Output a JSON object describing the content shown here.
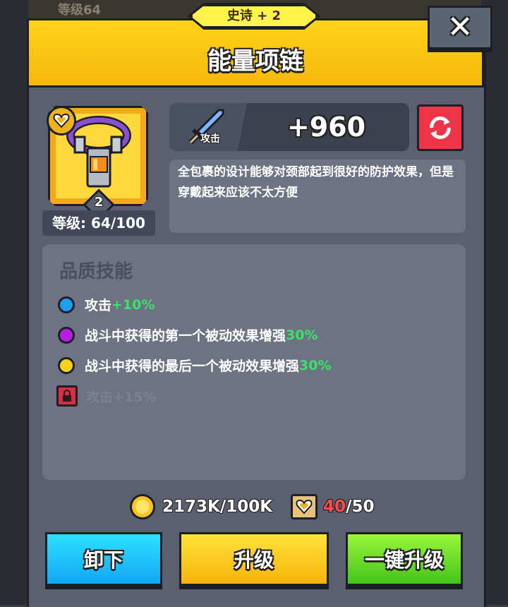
{
  "background": {
    "top_left_text": "等级64"
  },
  "header": {
    "rarity": "史诗 + 2",
    "title": "能量项链",
    "close_symbol": "✕"
  },
  "item": {
    "icon": "necklace-icon",
    "quality_icon": "heart-badge-icon",
    "star_count": "2",
    "level_text": "等级: 64/100"
  },
  "stat": {
    "icon": "sword-icon",
    "label": "攻击",
    "value": "+960",
    "swap_icon": "refresh-icon"
  },
  "description": "全包裹的设计能够对颈部起到很好的防护效果，但是穿戴起来应该不太方便",
  "skills": {
    "title": "品质技能",
    "items": [
      {
        "color": "#1e9ef0",
        "text": "攻击",
        "value": "+10%",
        "locked": false
      },
      {
        "color": "#b41fe0",
        "text": "战斗中获得的第一个被动效果增强",
        "value": "30%",
        "locked": false
      },
      {
        "color": "#f7d21a",
        "text": "战斗中获得的最后一个被动效果增强",
        "value": "30%",
        "locked": false
      },
      {
        "color": "#d23044",
        "text": "攻击+15%",
        "value": "",
        "locked": true
      }
    ]
  },
  "resources": {
    "coins": "2173K/100K",
    "scroll_have": "40",
    "scroll_need": "/50"
  },
  "buttons": {
    "unequip": "卸下",
    "upgrade": "升级",
    "upgrade_all": "一键升级"
  },
  "colors": {
    "header": "#f6b80a",
    "panel": "#5a6070",
    "accent_green": "#39e36a",
    "accent_red": "#ff4a4a"
  }
}
